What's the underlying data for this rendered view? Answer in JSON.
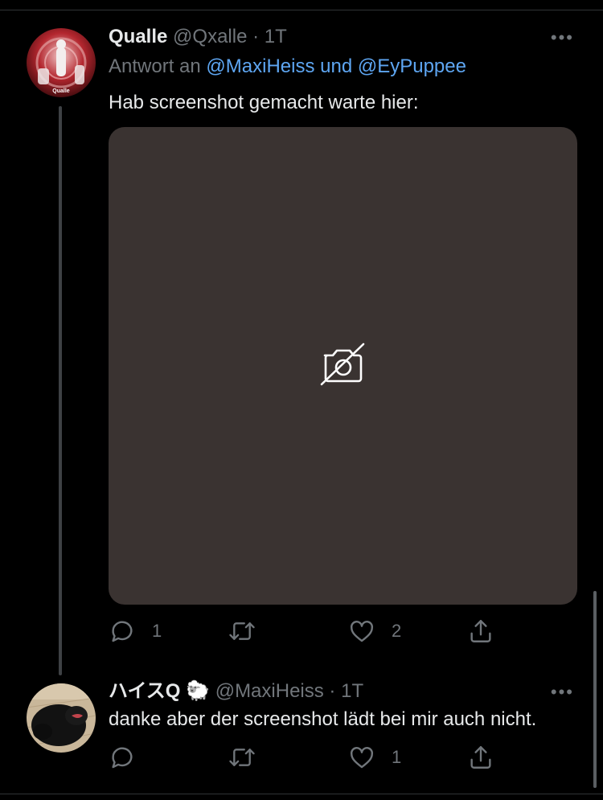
{
  "tweets": [
    {
      "name": "Qualle",
      "handle": "@Qxalle",
      "separator": "·",
      "time": "1T",
      "reply_prefix": "Antwort an",
      "mention1": "@MaxiHeiss",
      "reply_and": "und",
      "mention2": "@EyPuppee",
      "text": "Hab screenshot gemacht warte hier:",
      "avatar_caption": "Qualle",
      "reply_count": "1",
      "retweet_count": "",
      "like_count": "2",
      "more_label": "•••"
    },
    {
      "name": "ハイスQ",
      "emoji": "🐑",
      "handle": "@MaxiHeiss",
      "separator": "·",
      "time": "1T",
      "text": "danke aber der screenshot lädt bei mir auch nicht.",
      "reply_count": "",
      "retweet_count": "",
      "like_count": "1",
      "more_label": "•••"
    }
  ],
  "colors": {
    "background": "#000000",
    "text": "#e7e9ea",
    "muted": "#71767b",
    "link": "#5ea6f2",
    "media_placeholder": "#3a3331"
  },
  "icons": [
    "reply-icon",
    "retweet-icon",
    "like-icon",
    "share-icon",
    "image-unavailable-icon",
    "more-icon"
  ]
}
